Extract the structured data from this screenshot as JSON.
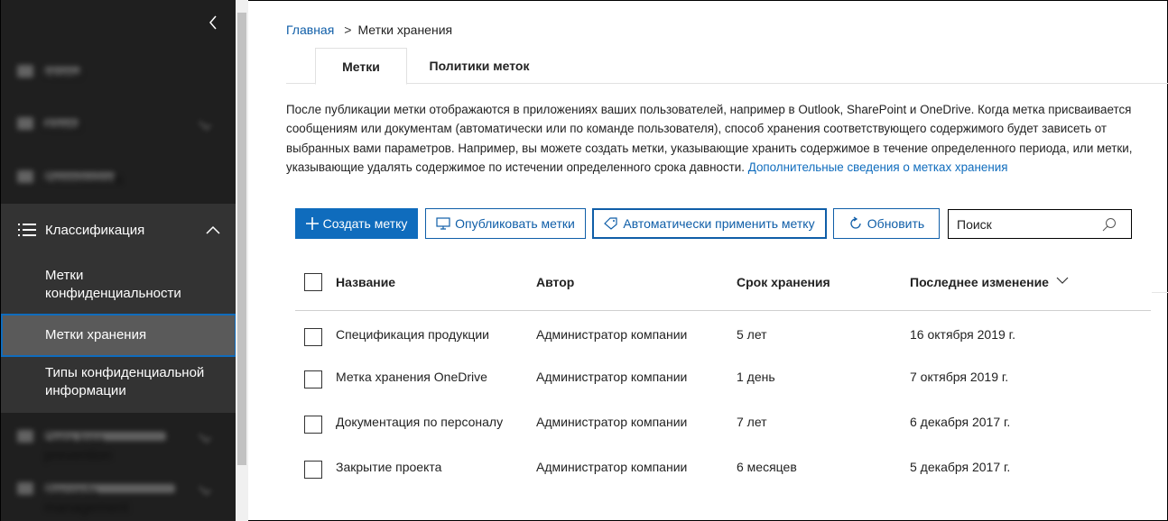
{
  "sidebar": {
    "collapse_icon": "chevron-left-icon",
    "blurred_items": [
      {
        "label": "Home"
      },
      {
        "label": "Alerts"
      },
      {
        "label": "Permissions"
      },
      {
        "label": "Data loss prevention"
      },
      {
        "label": "Records management"
      }
    ],
    "classification": {
      "label": "Классификация",
      "icon": "list-icon",
      "expanded": true,
      "items": [
        {
          "label": "Метки конфиденциальности"
        },
        {
          "label": "Метки хранения",
          "active": true
        },
        {
          "label": "Типы конфиденциальной информации"
        }
      ]
    }
  },
  "breadcrumb": {
    "home": "Главная",
    "separator": ">",
    "current": "Метки хранения"
  },
  "tabs": [
    {
      "label": "Метки",
      "active": true
    },
    {
      "label": "Политики меток",
      "active": false
    }
  ],
  "intro": {
    "text": "После публикации метки отображаются в приложениях ваших пользователей, например в Outlook, SharePoint и OneDrive. Когда метка присваивается сообщениям или документам (автоматически или по команде пользователя), способ хранения соответствующего содержимого будет зависеть от выбранных вами параметров. Например, вы можете создать метки, указывающие хранить содержимое в течение определенного периода, или метки, указывающие удалять содержимое по истечении определенного срока давности.",
    "link": "Дополнительные сведения о метках хранения"
  },
  "toolbar": {
    "create": "Создать метку",
    "publish": "Опубликовать метки",
    "auto_apply": "Автоматически применить метку",
    "refresh": "Обновить",
    "search_placeholder": "Поиск"
  },
  "table": {
    "columns": [
      "Название",
      "Автор",
      "Срок хранения",
      "Последнее изменение"
    ],
    "sort_icon": "chevron-down-icon",
    "rows": [
      {
        "name": "Спецификация продукции",
        "author": "Администратор компании",
        "retention": "5 лет",
        "modified": "16 октября 2019 г."
      },
      {
        "name": "Метка хранения OneDrive",
        "author": "Администратор компании",
        "retention": "1 день",
        "modified": "7 октября 2019 г."
      },
      {
        "name": "Документация по персоналу",
        "author": "Администратор компании",
        "retention": "7 лет",
        "modified": "6 декабря 2017 г."
      },
      {
        "name": "Закрытие проекта",
        "author": "Администратор компании",
        "retention": "6 месяцев",
        "modified": "5 декабря 2017 г."
      }
    ]
  },
  "colors": {
    "accent": "#0f6cbd",
    "link": "#0f5ea8",
    "sidebar_bg": "#1f1f1f",
    "sidebar_group_bg": "#333333",
    "sidebar_active_bg": "#5a5a5a"
  }
}
